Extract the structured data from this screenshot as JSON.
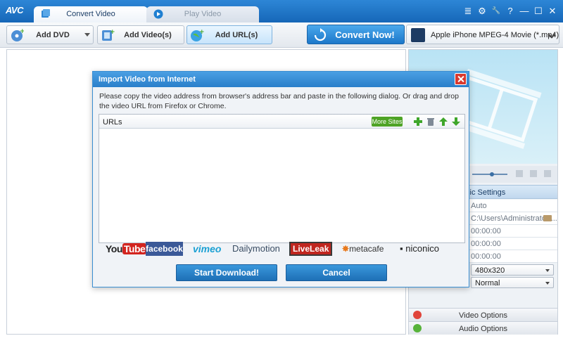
{
  "app": {
    "logo": "AVC",
    "tabs": [
      {
        "label": "Convert Video",
        "active": true
      },
      {
        "label": "Play Video",
        "active": false
      }
    ],
    "window_controls": [
      "≣",
      "⚙",
      "🔧",
      "?",
      "—",
      "☐",
      "✕"
    ]
  },
  "toolbar": {
    "add_dvd": "Add DVD",
    "add_videos": "Add Video(s)",
    "add_urls": "Add URL(s)",
    "convert_now": "Convert Now!",
    "profile": "Apple iPhone MPEG-4 Movie (*.mp4)"
  },
  "right_panel": {
    "basic_settings": "sic Settings",
    "rows": {
      "r1": "Auto",
      "r2": "C:\\Users\\Administrator\\...",
      "r3": "00:00:00",
      "r4": "00:00:00",
      "r5": "00:00:00",
      "resolution": "480x320",
      "quality": "Normal"
    },
    "video_options": "Video Options",
    "audio_options": "Audio Options"
  },
  "dialog": {
    "title": "Import Video from Internet",
    "instructions": "Please copy the video address from browser's address bar and paste in the following dialog. Or drag and drop the video URL from Firefox or Chrome.",
    "urls_header": "URLs",
    "more_sites": "More Sites",
    "sites": {
      "youtube_a": "You",
      "youtube_b": "Tube",
      "facebook": "facebook",
      "vimeo": "vimeo",
      "dailymotion": "Dailymotion",
      "liveleak": "LiveLeak",
      "metacafe": "metacafe",
      "niconico": "niconico"
    },
    "start_download": "Start Download!",
    "cancel": "Cancel"
  },
  "colors": {
    "title_blue": "#2a7fca",
    "close_red": "#d9392e",
    "more_sites_green": "#4ea325"
  }
}
